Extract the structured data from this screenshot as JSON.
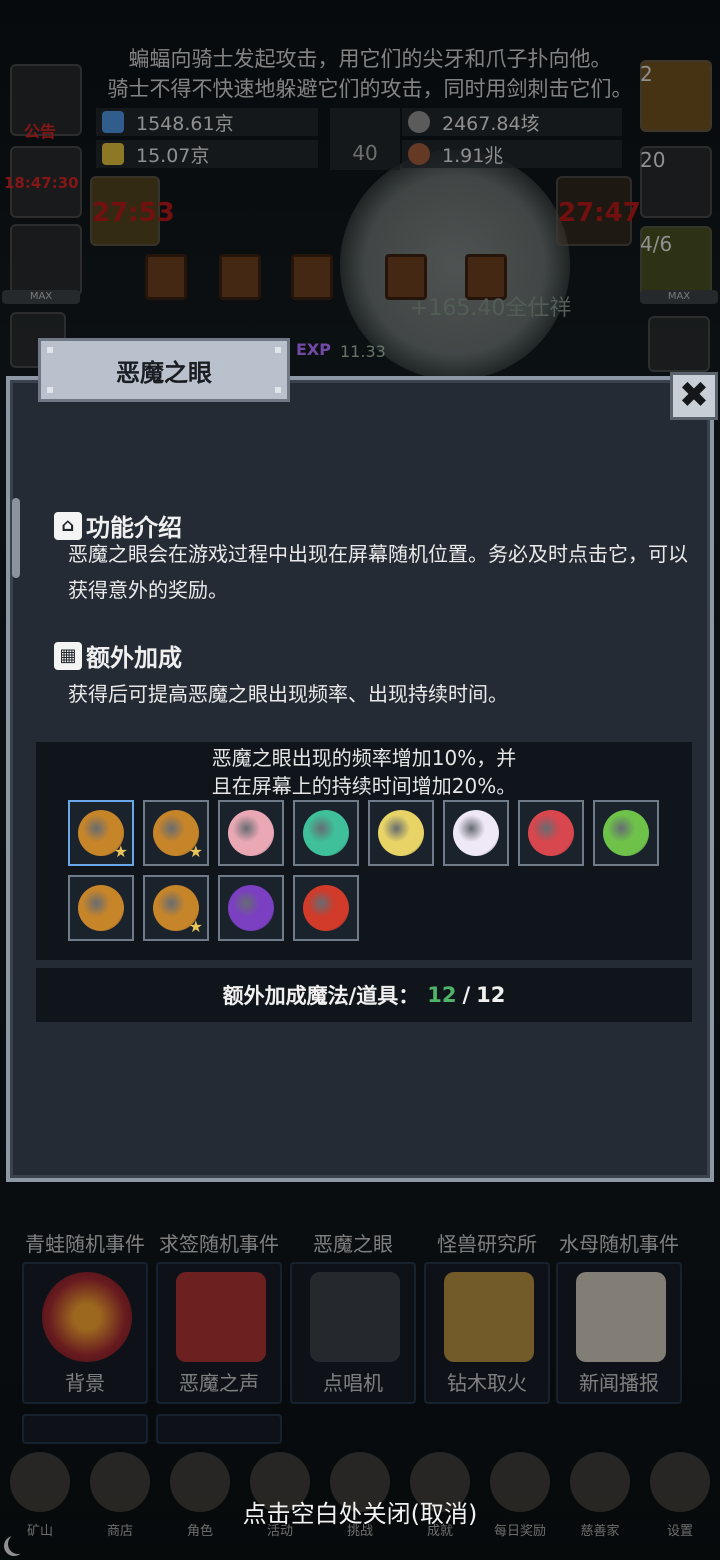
{
  "story": {
    "line1": "蝙蝠向骑士发起攻击，用它们的尖牙和爪子扑向他。",
    "line2": "骑士不得不快速地躲避它们的攻击，同时用剑刺击它们。"
  },
  "resources": {
    "gem_blue": "1548.61京",
    "gem_gold": "15.07京",
    "book_count": "40",
    "ore": "2467.84垓",
    "meat": "1.91兆"
  },
  "side": {
    "notice_label": "公告",
    "clock_label": "18:47:30",
    "timer_left": "27:53",
    "timer_right": "27:47",
    "potion_count": "2",
    "chest_count": "20",
    "slime_count": "4/6",
    "max_label": "MAX",
    "gold_popup": "+165.40全仕祥",
    "exp_label": "EXP",
    "exp_value": "11.33"
  },
  "modal": {
    "title": "恶魔之眼",
    "close_glyph": "✖",
    "section1_title": "功能介绍",
    "section1_text": "恶魔之眼会在游戏过程中出现在屏幕随机位置。务必及时点击它，可以获得意外的奖励。",
    "section2_title": "额外加成",
    "section2_text": "获得后可提高恶魔之眼出现频率、出现持续时间。",
    "bonus_desc_line1": "恶魔之眼出现的频率增加10%，并",
    "bonus_desc_line2": "且在屏幕上的持续时间增加20%。",
    "count_label": "额外加成魔法/道具：",
    "count_current": "12",
    "count_sep": "/",
    "count_total": "12",
    "items": [
      {
        "icon": "eye-orange-icon",
        "color": "#c7852a",
        "star": true
      },
      {
        "icon": "eye-orange-icon",
        "color": "#c7852a",
        "star": true
      },
      {
        "icon": "rabbit-girl-icon",
        "color": "#e9a8b4",
        "star": false
      },
      {
        "icon": "eye-green-icon",
        "color": "#3fbf9a",
        "star": false
      },
      {
        "icon": "moon-coin-icon",
        "color": "#e8d466",
        "star": false
      },
      {
        "icon": "ghost-icon",
        "color": "#efe8f6",
        "star": false
      },
      {
        "icon": "heart-icon",
        "color": "#d8464e",
        "star": false
      },
      {
        "icon": "cash-icon",
        "color": "#6ec24a",
        "star": false
      },
      {
        "icon": "eye-orange-icon",
        "color": "#c7852a",
        "star": false
      },
      {
        "icon": "eye-orange-icon",
        "color": "#c7852a",
        "star": true
      },
      {
        "icon": "eye-purple-icon",
        "color": "#7b3fc2",
        "star": false
      },
      {
        "icon": "lantern-icon",
        "color": "#d23a2a",
        "star": false
      }
    ]
  },
  "grid": {
    "row1": [
      "青蛙随机事件",
      "求签随机事件",
      "恶魔之眼",
      "怪兽研究所",
      "水母随机事件"
    ],
    "row2": [
      "背景",
      "恶魔之声",
      "点唱机",
      "钻木取火",
      "新闻播报"
    ]
  },
  "nav": {
    "items": [
      "矿山",
      "商店",
      "角色",
      "活动",
      "挑战",
      "成就",
      "每日奖励",
      "慈善家",
      "设置"
    ],
    "close_hint": "点击空白处关闭(取消)"
  }
}
